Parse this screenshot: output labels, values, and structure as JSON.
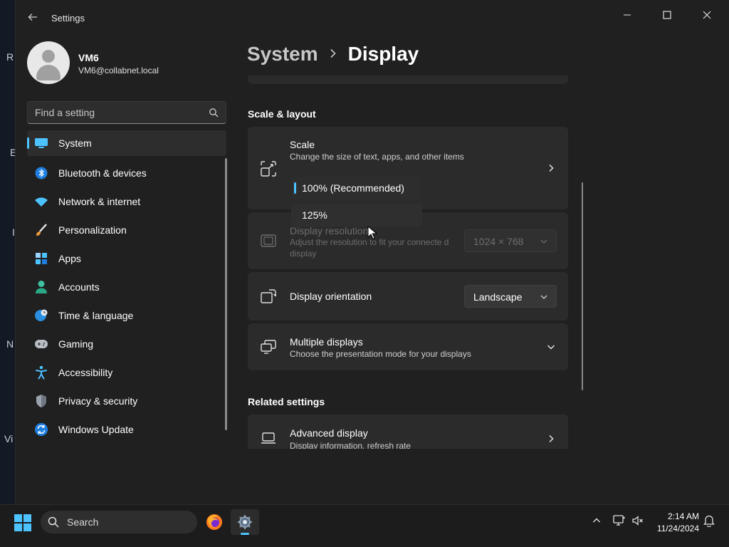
{
  "window": {
    "app_title": "Settings",
    "user": {
      "name": "VM6",
      "email": "VM6@collabnet.local"
    },
    "search": {
      "placeholder": "Find a setting"
    },
    "desktop_letters": [
      "R",
      "E",
      "I",
      "N",
      "Vi"
    ]
  },
  "sidebar": {
    "items": [
      {
        "label": "System",
        "icon": "system-icon",
        "selected": true
      },
      {
        "label": "Bluetooth & devices",
        "icon": "bluetooth-icon"
      },
      {
        "label": "Network & internet",
        "icon": "wifi-icon"
      },
      {
        "label": "Personalization",
        "icon": "brush-icon"
      },
      {
        "label": "Apps",
        "icon": "apps-icon"
      },
      {
        "label": "Accounts",
        "icon": "person-icon"
      },
      {
        "label": "Time & language",
        "icon": "globe-clock-icon"
      },
      {
        "label": "Gaming",
        "icon": "gamepad-icon"
      },
      {
        "label": "Accessibility",
        "icon": "accessibility-icon"
      },
      {
        "label": "Privacy & security",
        "icon": "shield-icon"
      },
      {
        "label": "Windows Update",
        "icon": "update-icon"
      }
    ]
  },
  "main": {
    "breadcrumb": {
      "parent": "System",
      "current": "Display"
    },
    "section_scale_layout": "Scale & layout",
    "scale": {
      "title": "Scale",
      "subtitle": "Change the size of text, apps, and other items",
      "options": [
        "100% (Recommended)",
        "125%"
      ],
      "selected": "100% (Recommended)"
    },
    "resolution": {
      "title": "Display resolution",
      "subtitle": "Adjust the resolution to fit your connecte d display",
      "value": "1024 × 768"
    },
    "orientation": {
      "title": "Display orientation",
      "value": "Landscape"
    },
    "multiple_displays": {
      "title": "Multiple displays",
      "subtitle": "Choose the presentation mode for your displays"
    },
    "section_related": "Related settings",
    "advanced_display": {
      "title": "Advanced display",
      "subtitle": "Display information, refresh rate"
    }
  },
  "taskbar": {
    "search_label": "Search",
    "clock": {
      "time": "2:14 AM",
      "date": "11/24/2024"
    }
  },
  "colors": {
    "accent": "#4cc2ff",
    "window_bg": "#202020",
    "card_bg": "#2b2b2b"
  }
}
